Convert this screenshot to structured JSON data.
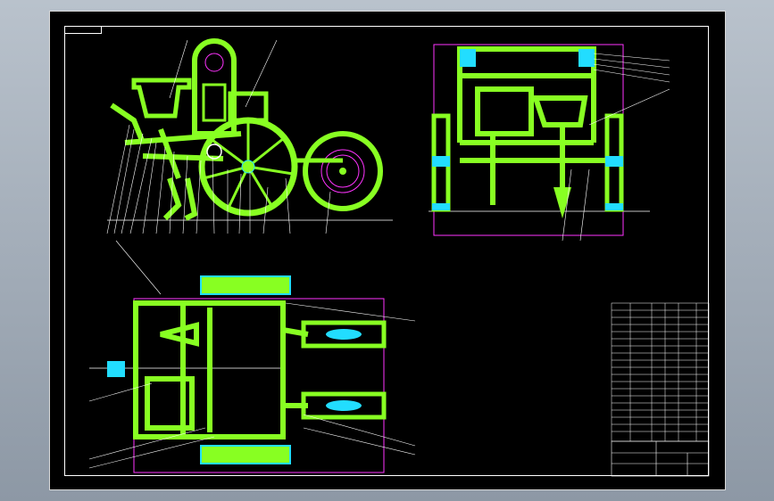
{
  "title_block": {
    "drawing_title": "",
    "school": "",
    "scale": "",
    "sheet": ""
  },
  "colors": {
    "background": "#000000",
    "outline": "#ffffff",
    "part_fill": "#88ff22",
    "accent_cyan": "#22ddff",
    "accent_magenta": "#ff33ff",
    "note_text": "#33ff33"
  },
  "views": [
    "side-view",
    "rear-view",
    "top-view"
  ],
  "notes": []
}
